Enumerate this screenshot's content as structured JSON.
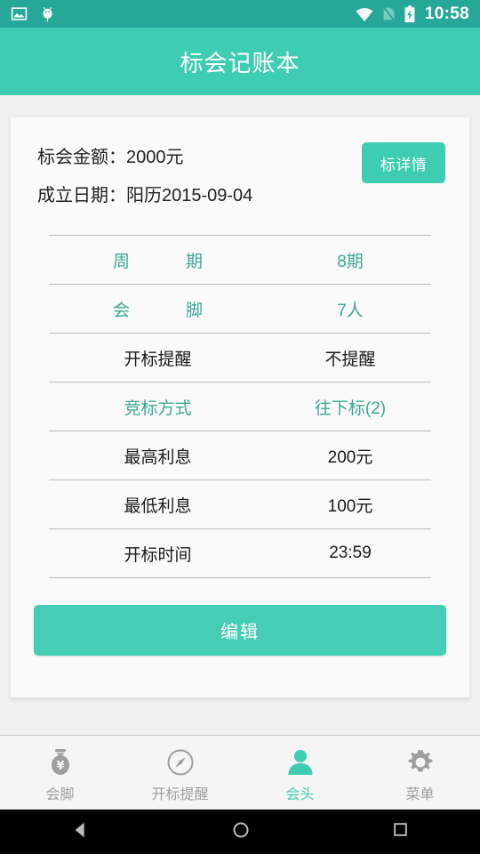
{
  "status_bar": {
    "icons_left": [
      "image-icon",
      "android-robot-icon"
    ],
    "icons_right": [
      "wifi-alert-icon",
      "no-sim-icon",
      "battery-charging-icon"
    ],
    "time": "10:58"
  },
  "app_bar": {
    "title": "标会记账本"
  },
  "summary": {
    "amount_label": "标会金额：",
    "amount_value": "2000元",
    "date_label": "成立日期：",
    "date_value": "阳历2015-09-04",
    "detail_button": "标详情"
  },
  "table": {
    "rows": [
      {
        "label": "周　期",
        "value": "8期",
        "label_color": "#3aa795",
        "value_color": "#3aa795",
        "spaced": true
      },
      {
        "label": "会　脚",
        "value": "7人",
        "label_color": "#3aa795",
        "value_color": "#3aa795",
        "spaced": true
      },
      {
        "label": "开标提醒",
        "value": "不提醒",
        "label_color": "#1a1a1a",
        "value_color": "#1a1a1a",
        "spaced": false
      },
      {
        "label": "竞标方式",
        "value": "往下标(2)",
        "label_color": "#3aa795",
        "value_color": "#3aa795",
        "spaced": false
      },
      {
        "label": "最高利息",
        "value": "200元",
        "label_color": "#1a1a1a",
        "value_color": "#1a1a1a",
        "spaced": false
      },
      {
        "label": "最低利息",
        "value": "100元",
        "label_color": "#1a1a1a",
        "value_color": "#1a1a1a",
        "spaced": false
      },
      {
        "label": "开标时间",
        "value": "23:59",
        "label_color": "#1a1a1a",
        "value_color": "#1a1a1a",
        "spaced": false
      }
    ]
  },
  "edit": {
    "label": "编辑"
  },
  "bottom_nav": {
    "items": [
      {
        "label": "会脚",
        "icon": "money-bag-icon",
        "active": false
      },
      {
        "label": "开标提醒",
        "icon": "compass-icon",
        "active": false
      },
      {
        "label": "会头",
        "icon": "person-icon",
        "active": true
      },
      {
        "label": "菜单",
        "icon": "gear-icon",
        "active": false
      }
    ]
  },
  "system_nav": {
    "buttons": [
      "back-icon",
      "home-icon",
      "recents-icon"
    ]
  },
  "colors": {
    "accent": "#3ecdb2",
    "status_bar": "#27a797",
    "teal_text": "#3aa795",
    "page_bg": "#f0f0f0",
    "card_bg": "#fafafa",
    "inactive_nav": "#9e9e9e"
  }
}
